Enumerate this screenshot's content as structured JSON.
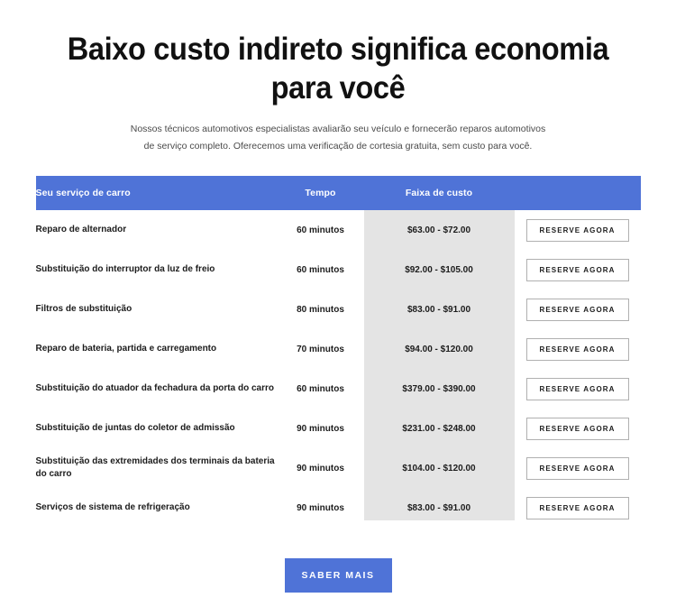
{
  "hero": {
    "title": "Baixo custo indireto significa economia para você",
    "subtitle": "Nossos técnicos automotivos especialistas avaliarão seu veículo e fornecerão reparos automotivos de serviço completo. Oferecemos uma verificação de cortesia gratuita, sem custo para você."
  },
  "colors": {
    "accent": "#4f73d7",
    "price_band": "#e4e4e4",
    "header_text": "#ffffff",
    "body_text": "#1c1c1c",
    "subtitle_text": "#4a4a4a",
    "button_border": "#b0b0b0"
  },
  "table": {
    "headers": {
      "service": "Seu serviço de carro",
      "time": "Tempo",
      "price": "Faixa de custo",
      "action": ""
    },
    "action_label": "RESERVE AGORA",
    "rows": [
      {
        "service": "Reparo de alternador",
        "time": "60 minutos",
        "price": "$63.00 - $72.00",
        "action": "RESERVE AGORA"
      },
      {
        "service": "Substituição do interruptor da luz de freio",
        "time": "60 minutos",
        "price": "$92.00 - $105.00",
        "action": "RESERVE AGORA"
      },
      {
        "service": "Filtros de substituição",
        "time": "80 minutos",
        "price": "$83.00 - $91.00",
        "action": "RESERVE AGORA"
      },
      {
        "service": "Reparo de bateria, partida e carregamento",
        "time": "70 minutos",
        "price": "$94.00 - $120.00",
        "action": "RESERVE AGORA"
      },
      {
        "service": "Substituição do atuador da fechadura da porta do carro",
        "time": "60 minutos",
        "price": "$379.00 - $390.00",
        "action": "RESERVE AGORA"
      },
      {
        "service": "Substituição de juntas do coletor de admissão",
        "time": "90 minutos",
        "price": "$231.00 - $248.00",
        "action": "RESERVE AGORA"
      },
      {
        "service": "Substituição das extremidades dos terminais da bateria do carro",
        "time": "90 minutos",
        "price": "$104.00 - $120.00",
        "action": "RESERVE AGORA"
      },
      {
        "service": "Serviços de sistema de refrigeração",
        "time": "90 minutos",
        "price": "$83.00 - $91.00",
        "action": "RESERVE AGORA"
      }
    ]
  },
  "cta": {
    "label": "SABER MAIS"
  }
}
